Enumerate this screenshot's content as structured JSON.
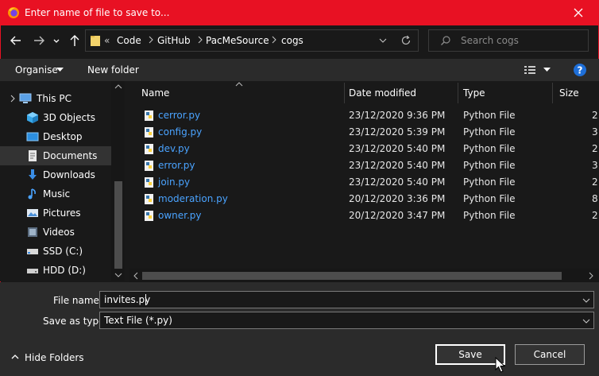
{
  "window": {
    "title": "Enter name of file to save to..."
  },
  "address": {
    "overflow": "«",
    "crumbs": [
      "Code",
      "GitHub",
      "PacMeSource",
      "cogs"
    ]
  },
  "search": {
    "placeholder": "Search cogs"
  },
  "toolbar": {
    "organise": "Organise",
    "new_folder": "New folder"
  },
  "nav": {
    "items": [
      {
        "label": "This PC",
        "icon": "computer-icon"
      },
      {
        "label": "3D Objects",
        "icon": "cube-icon"
      },
      {
        "label": "Desktop",
        "icon": "desktop-icon"
      },
      {
        "label": "Documents",
        "icon": "document-icon",
        "selected": true
      },
      {
        "label": "Downloads",
        "icon": "download-icon"
      },
      {
        "label": "Music",
        "icon": "music-icon"
      },
      {
        "label": "Pictures",
        "icon": "picture-icon"
      },
      {
        "label": "Videos",
        "icon": "video-icon"
      },
      {
        "label": "SSD (C:)",
        "icon": "ssd-drive-icon"
      },
      {
        "label": "HDD (D:)",
        "icon": "hdd-drive-icon"
      }
    ]
  },
  "columns": {
    "name": "Name",
    "date": "Date modified",
    "type": "Type",
    "size": "Size"
  },
  "files": [
    {
      "name": "cerror.py",
      "date": "23/12/2020 9:36 PM",
      "type": "Python File",
      "size": "2"
    },
    {
      "name": "config.py",
      "date": "23/12/2020 5:39 PM",
      "type": "Python File",
      "size": "3"
    },
    {
      "name": "dev.py",
      "date": "23/12/2020 5:40 PM",
      "type": "Python File",
      "size": "2"
    },
    {
      "name": "error.py",
      "date": "23/12/2020 5:40 PM",
      "type": "Python File",
      "size": "3"
    },
    {
      "name": "join.py",
      "date": "23/12/2020 5:40 PM",
      "type": "Python File",
      "size": "2"
    },
    {
      "name": "moderation.py",
      "date": "20/12/2020 3:36 PM",
      "type": "Python File",
      "size": "8"
    },
    {
      "name": "owner.py",
      "date": "20/12/2020 3:47 PM",
      "type": "Python File",
      "size": "2"
    }
  ],
  "form": {
    "file_name_label": "File name:",
    "file_name_value": "invites.py",
    "type_label": "Save as type:",
    "type_value": "Text File (*.py)"
  },
  "footer": {
    "hide_folders": "Hide Folders",
    "save": "Save",
    "cancel": "Cancel"
  },
  "colors": {
    "titlebar": "#e81123",
    "link": "#4aa3ff",
    "help": "#1e6fd9"
  }
}
